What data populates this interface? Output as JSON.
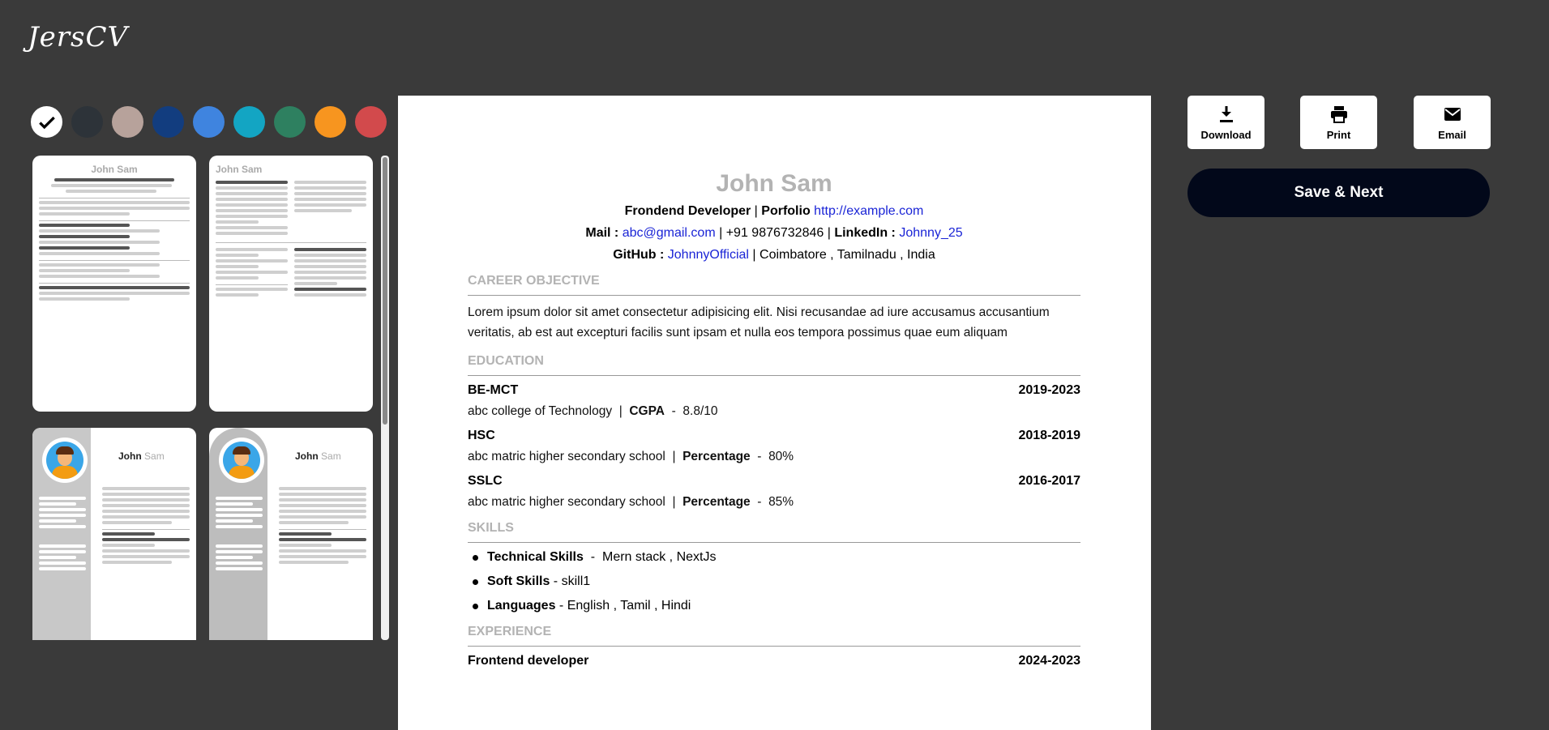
{
  "app": {
    "logo": "JersCV"
  },
  "swatches": [
    {
      "color": "#ffffff",
      "selected": true,
      "icon": "check-icon"
    },
    {
      "color": "#2d3339"
    },
    {
      "color": "#b7a29b"
    },
    {
      "color": "#123d7f"
    },
    {
      "color": "#3f84df"
    },
    {
      "color": "#13a5c3"
    },
    {
      "color": "#2e8060"
    },
    {
      "color": "#f7951f"
    },
    {
      "color": "#d24a4c"
    }
  ],
  "templates": {
    "t1": {
      "name": "John Sam"
    },
    "t2": {
      "name": "John Sam"
    },
    "t3": {
      "first": "John",
      "last": "Sam"
    },
    "t4": {
      "first": "John",
      "last": "Sam"
    }
  },
  "actions": {
    "download": "Download",
    "print": "Print",
    "email": "Email",
    "save_next": "Save & Next"
  },
  "resume": {
    "name": "John Sam",
    "role": "Frondend Developer",
    "porfolio_label": "Porfolio",
    "porfolio_url": "http://example.com",
    "mail_label": "Mail :",
    "mail": "abc@gmail.com",
    "phone": "+91 9876732846",
    "linkedin_label": "LinkedIn :",
    "linkedin": "Johnny_25",
    "github_label": "GitHub :",
    "github": "JohnnyOfficial",
    "location": "Coimbatore , Tamilnadu , India",
    "sections": {
      "career": "CAREER OBJECTIVE",
      "education": "EDUCATION",
      "skills": "SKILLS",
      "experience": "EXPERIENCE"
    },
    "career_text": "Lorem ipsum dolor sit amet consectetur adipisicing elit. Nisi recusandae ad iure accusamus accusantium veritatis, ab est aut excepturi facilis sunt ipsam et nulla eos tempora possimus quae eum aliquam",
    "education": [
      {
        "degree": "BE-MCT",
        "years": "2019-2023",
        "school": "abc college of Technology",
        "metric_label": "CGPA",
        "metric": "8.8/10"
      },
      {
        "degree": "HSC",
        "years": "2018-2019",
        "school": "abc matric higher secondary school",
        "metric_label": "Percentage",
        "metric": "80%"
      },
      {
        "degree": "SSLC",
        "years": "2016-2017",
        "school": "abc matric higher secondary school",
        "metric_label": "Percentage",
        "metric": "85%"
      }
    ],
    "skills": [
      {
        "label": "Technical Skills",
        "value": "Mern stack ,  NextJs"
      },
      {
        "label": "Soft Skills",
        "value": "skill1"
      },
      {
        "label": "Languages",
        "value": "English , Tamil , Hindi"
      }
    ],
    "experience": [
      {
        "title": "Frontend developer",
        "years": "2024-2023"
      }
    ]
  }
}
